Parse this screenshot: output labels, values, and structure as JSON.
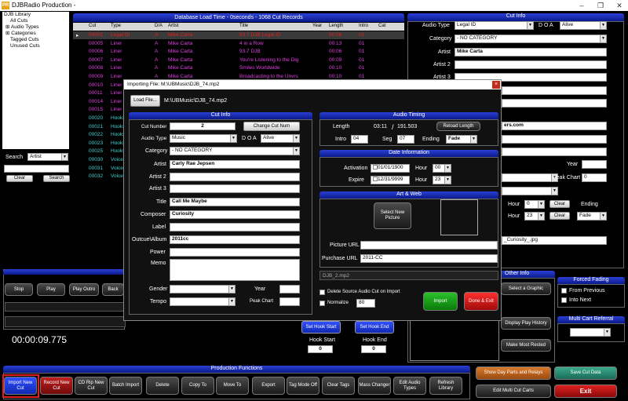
{
  "window": {
    "title": "DJBRadio Production -",
    "logo": "PR"
  },
  "tree": {
    "items": [
      "DJB Library",
      "All Cuts",
      "Audio Types",
      "Categories",
      "Tagged Cuts",
      "Unused Cuts"
    ]
  },
  "search": {
    "label": "Search",
    "field": "Artist",
    "clear": "Clear",
    "search": "Search"
  },
  "grid": {
    "title": "Database Load Time - 0seconds - 1068 Cut Records",
    "columns": [
      "Cut",
      "Type",
      "D/A",
      "Artist",
      "Title",
      "Year",
      "Length",
      "Intro",
      "Cat"
    ],
    "rows": [
      {
        "cut": "00001",
        "type": "Legal ID",
        "da": "A",
        "artist": "Mike Carta",
        "title": "93.7 DJB Legal ID",
        "length": "00:08",
        "intro": "01"
      },
      {
        "cut": "00005",
        "type": "Liner",
        "da": "A",
        "artist": "Mike Carta",
        "title": "4 in a Row",
        "length": "00:13",
        "intro": "01"
      },
      {
        "cut": "00006",
        "type": "Liner",
        "da": "A",
        "artist": "Mike Carta",
        "title": "93.7 DJB",
        "length": "00:06",
        "intro": "01"
      },
      {
        "cut": "00007",
        "type": "Liner",
        "da": "A",
        "artist": "Mike Carta",
        "title": "You're Listening to the Dig",
        "length": "00:09",
        "intro": "01"
      },
      {
        "cut": "00008",
        "type": "Liner",
        "da": "A",
        "artist": "Mike Carta",
        "title": "Smiles Worldwide",
        "length": "00:10",
        "intro": "01"
      },
      {
        "cut": "00009",
        "type": "Liner",
        "da": "A",
        "artist": "Mike Carta",
        "title": "Broadcasting to the Unvrs",
        "length": "00:10",
        "intro": "01"
      },
      {
        "cut": "00010",
        "type": "Liner"
      },
      {
        "cut": "00011",
        "type": "Liner"
      },
      {
        "cut": "00014",
        "type": "Liner"
      },
      {
        "cut": "00015",
        "type": "Liner"
      },
      {
        "cut": "00020",
        "type": "Hooks"
      },
      {
        "cut": "00021",
        "type": "Hooks"
      },
      {
        "cut": "00022",
        "type": "Hooks"
      },
      {
        "cut": "00023",
        "type": "Hooks"
      },
      {
        "cut": "00025",
        "type": "Hooks"
      },
      {
        "cut": "00030",
        "type": "Voicer"
      },
      {
        "cut": "00031",
        "type": "Voicer"
      },
      {
        "cut": "00032",
        "type": "Voicer"
      }
    ]
  },
  "cutinfo": {
    "title": "Cut Info",
    "audio_type_label": "Audio Type",
    "audio_type": "Legal ID",
    "doa_label": "D O A",
    "doa": "Alive",
    "category_label": "Category",
    "category": "- NO CATEGORY",
    "artist_label": "Artist",
    "artist": "Mike Carta",
    "artist2_label": "Artist 2",
    "artist3_label": "Artist 3",
    "partial_url": "ers.com",
    "year_label": "Year",
    "peak_chart_label": "Peak Chart",
    "peak_chart": "0",
    "hour_label": "Hour",
    "hour1": "0",
    "hour2": "23",
    "clear": "Clear",
    "ending_label": "Ending",
    "ending": "Fade",
    "file_value": "_Curiosity_.jpg"
  },
  "transport": {
    "stop": "Stop",
    "play": "Play",
    "play_outro": "Play Outro",
    "back": "Back"
  },
  "timer": "00:00:09.775",
  "hook": {
    "set_start": "Set Hook Start",
    "set_end": "Set Hook End",
    "start_label": "Hook Start",
    "end_label": "Hook End",
    "start": "0",
    "end": "0"
  },
  "other_info": {
    "title": "Other Info",
    "graphic": "Select a Graphic",
    "play_history": "Display Play History",
    "most_rested": "Make Most Rested"
  },
  "forced_fading": {
    "title": "Forced Fading",
    "from_previous": "From Previous",
    "into_next": "Into Next"
  },
  "multicart": {
    "title": "Multi Cart Referral"
  },
  "right_buttons": {
    "show_day_parts": "Show Day Parts and Relays",
    "save": "Save Cut Data",
    "edit_multi": "Edit Multi Cut Carts",
    "exit": "Exit"
  },
  "production": {
    "title": "Production Functions",
    "buttons": [
      "Import New Cut",
      "Record New Cut",
      "CD Rip New Cut",
      "Batch Import",
      "Delete",
      "Copy To",
      "Move To",
      "Export",
      "Tag Mode Off",
      "Clear Tags",
      "Mass Changer",
      "Edit Audio Types",
      "Refresh Library"
    ]
  },
  "dialog": {
    "title": "Importing File: M:\\UBMusic\\DJB_74.mp2",
    "load_file": "Load File...",
    "path": "M:\\UBMusic\\DJB_74.mp2",
    "cutinfo": {
      "title": "Cut Info",
      "cut_number_label": "Cut Number",
      "cut_number": "2",
      "change_cut": "Change Cut Num",
      "audio_type_label": "Audio Type",
      "audio_type": "Music",
      "doa_label": "D O A",
      "doa": "Alive",
      "category_label": "Category",
      "category": "- NO CATEGORY",
      "artist_label": "Artist",
      "artist": "Carly Rae Jepsen",
      "artist2_label": "Artist 2",
      "artist3_label": "Artist 3",
      "title_label": "Title",
      "title_value": "Call Me Maybe",
      "composer_label": "Composer",
      "composer": "Curiosity",
      "label_label": "Label",
      "outcue_label": "Outcue\\Album",
      "outcue": "2011cc",
      "power_label": "Power",
      "memo_label": "Memo",
      "gender_label": "Gender",
      "tempo_label": "Tempo",
      "year_label": "Year",
      "peak_chart_label": "Peak Chart"
    },
    "timing": {
      "title": "Audio Timing",
      "length_label": "Length",
      "length": "03:11",
      "sep": "/",
      "samples": "191.503",
      "reload": "Reload Length",
      "intro_label": "Intro",
      "intro": "04",
      "seg_label": "Seg",
      "seg": "07",
      "ending_label": "Ending",
      "ending": "Fade"
    },
    "dates": {
      "title": "Date Information",
      "activation_label": "Activation",
      "activation": "01/01/1900",
      "expire_label": "Expire",
      "expire": "12/31/9999",
      "hour_label": "Hour",
      "hour1": "00",
      "hour2": "23"
    },
    "art": {
      "title": "Art & Web",
      "select_picture": "Select New Picture",
      "picture_url_label": "Picture URL",
      "purchase_url_label": "Purchase URL",
      "purchase_url": "2011-CC"
    },
    "file_name": "DJB_2.mp2",
    "delete_source": "Delete Source Audio Cut on Import",
    "normalize": "Normalize",
    "normalize_value": "80",
    "import": "Import",
    "done_exit": "Done & Exit"
  },
  "colors": {
    "accent": "#1a30c8",
    "magenta": "#e040e0",
    "cyan": "#40d0d0",
    "import_btn": "#1aa01a",
    "done_btn": "#e02020",
    "highlight": "#e02020"
  }
}
